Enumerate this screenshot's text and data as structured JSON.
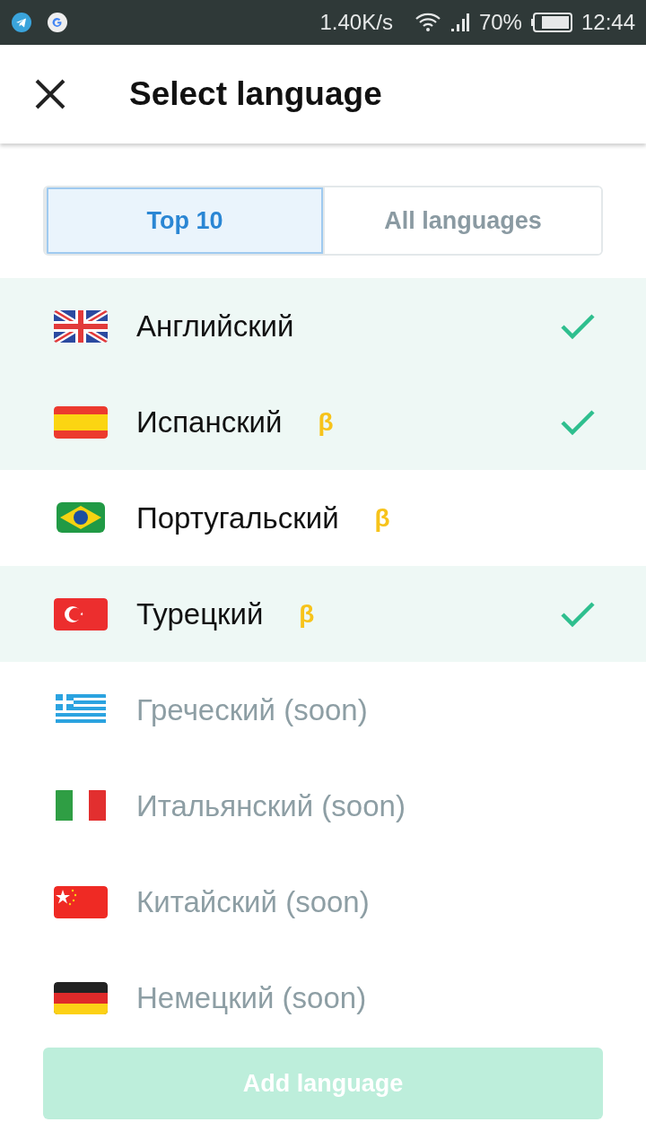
{
  "status_bar": {
    "speed": "1.40K/s",
    "battery": "70%",
    "time": "12:44"
  },
  "header": {
    "title": "Select language"
  },
  "tabs": [
    {
      "label": "Top 10",
      "selected": true
    },
    {
      "label": "All languages",
      "selected": false
    }
  ],
  "languages": [
    {
      "kind": "uk",
      "name": "Английский",
      "selected": true,
      "disabled": false
    },
    {
      "kind": "es",
      "name": "Испанский",
      "badge": "β",
      "selected": true,
      "disabled": false
    },
    {
      "kind": "br",
      "name": "Португальский",
      "badge": "β",
      "selected": false,
      "disabled": false
    },
    {
      "kind": "tr",
      "name": "Турецкий",
      "badge": "β",
      "selected": true,
      "disabled": false
    },
    {
      "kind": "gr",
      "name": "Греческий (soon)",
      "selected": false,
      "disabled": true
    },
    {
      "kind": "it",
      "name": "Итальянский (soon)",
      "selected": false,
      "disabled": true
    },
    {
      "kind": "cn",
      "name": "Китайский (soon)",
      "selected": false,
      "disabled": true
    },
    {
      "kind": "de",
      "name": "Немецкий (soon)",
      "selected": false,
      "disabled": true
    }
  ],
  "add_button": {
    "label": "Add language",
    "disabled": true
  }
}
